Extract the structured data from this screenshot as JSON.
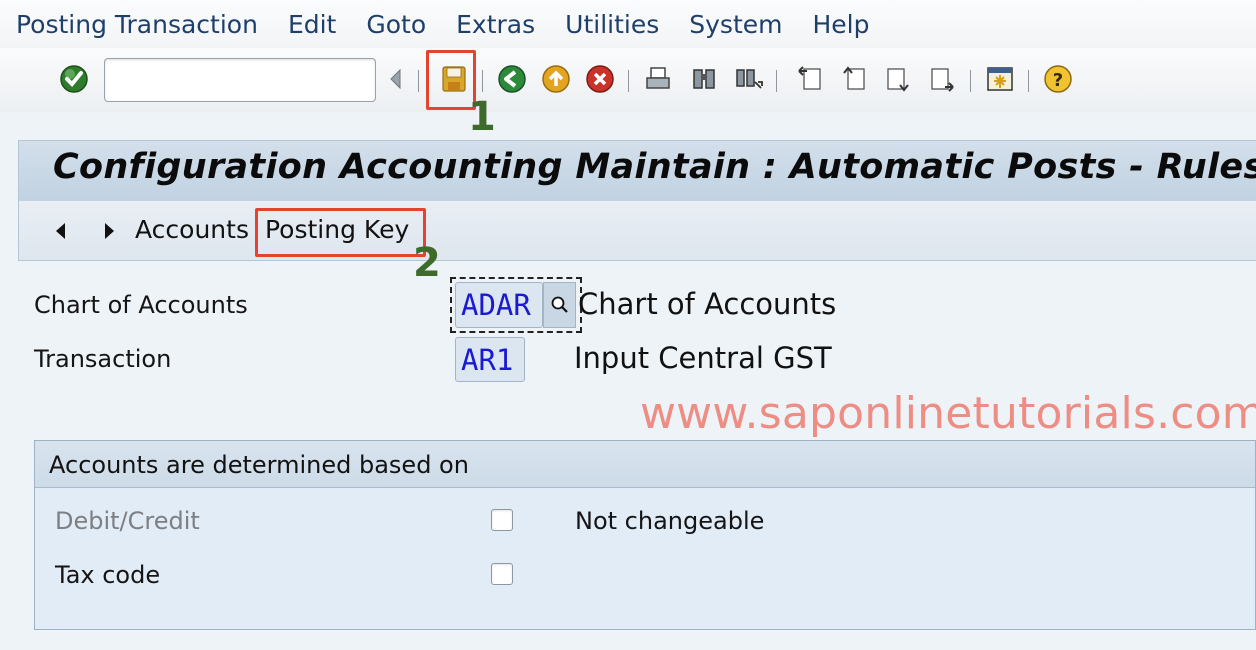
{
  "menu": [
    "Posting Transaction",
    "Edit",
    "Goto",
    "Extras",
    "Utilities",
    "System",
    "Help"
  ],
  "toolbar": {
    "command_value": "",
    "icons": [
      "enter-icon",
      "back-arrow-icon",
      "save-icon",
      "back-icon",
      "exit-icon",
      "cancel-icon",
      "print-icon",
      "find-icon",
      "find-next-icon",
      "first-page-icon",
      "previous-page-icon",
      "next-page-icon",
      "last-page-icon",
      "create-session-icon",
      "help-icon"
    ],
    "save_highlight_number": "1"
  },
  "title": "Configuration Accounting Maintain : Automatic Posts - Rules",
  "app_toolbar": {
    "prev_icon": "triangle-left-icon",
    "next_icon": "triangle-right-icon",
    "accounts_label": "Accounts",
    "posting_key_label": "Posting Key",
    "posting_key_highlight_number": "2"
  },
  "fields": {
    "chart_of_accounts": {
      "label": "Chart of Accounts",
      "value": "ADAR",
      "description": "Chart of Accounts"
    },
    "transaction": {
      "label": "Transaction",
      "value": "AR1",
      "description": "Input Central GST"
    }
  },
  "watermark": "www.saponlinetutorials.com",
  "group": {
    "title": "Accounts are determined based on",
    "debit_credit": {
      "label": "Debit/Credit",
      "checked": false,
      "disabled": true
    },
    "tax_code": {
      "label": "Tax code",
      "checked": false
    },
    "not_changeable_label": "Not changeable"
  },
  "colors": {
    "highlight": "#e2442f",
    "highlight_number": "#3e6a2b",
    "field_value": "#1a1ad0",
    "watermark": "#ee8d84"
  }
}
